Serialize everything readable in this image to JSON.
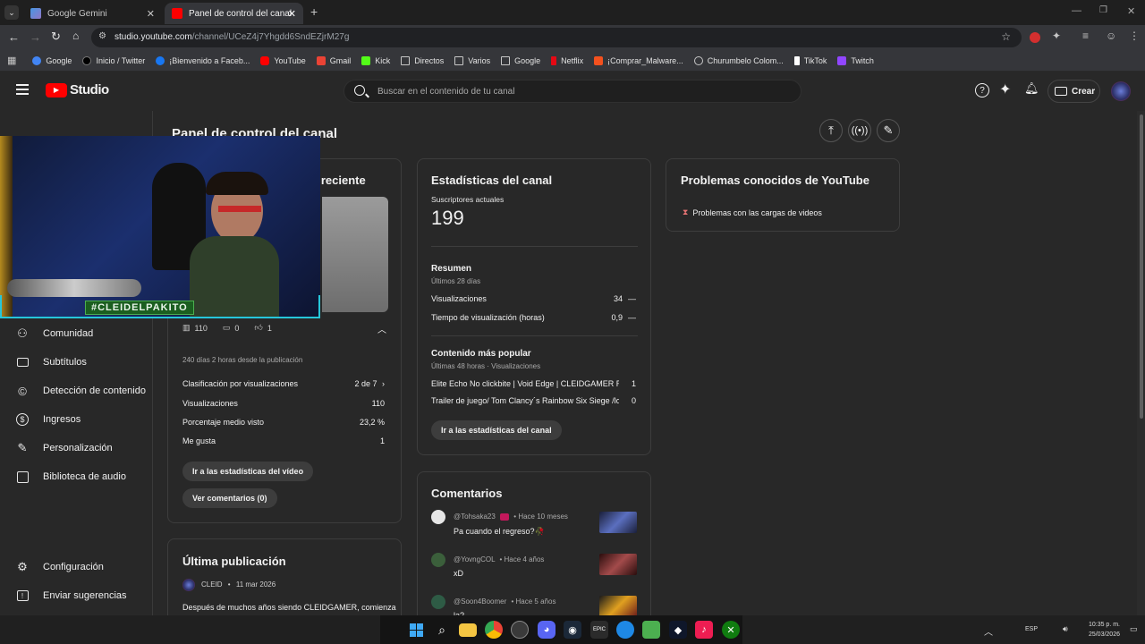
{
  "browser": {
    "tabs": [
      {
        "title": "Google Gemini",
        "active": false
      },
      {
        "title": "Panel de control del canal - You",
        "active": true
      }
    ],
    "url_host": "studio.youtube.com",
    "url_path": "/channel/UCeZ4j7Yhgdd6SndEZjrM27g",
    "bookmarks": [
      {
        "label": "Google",
        "color": "#4285f4"
      },
      {
        "label": "Inicio / Twitter",
        "color": "#ffffff"
      },
      {
        "label": "¡Bienvenido a Faceb...",
        "color": "#1877f2"
      },
      {
        "label": "YouTube",
        "color": "#ff0000"
      },
      {
        "label": "Gmail",
        "color": "#ea4335"
      },
      {
        "label": "Kick",
        "color": "#53fc18"
      },
      {
        "label": "Directos",
        "color": "#c7c7c7"
      },
      {
        "label": "Varios",
        "color": "#c7c7c7"
      },
      {
        "label": "Google",
        "color": "#c7c7c7"
      },
      {
        "label": "Netflix",
        "color": "#e50914"
      },
      {
        "label": "¡Comprar_Malware...",
        "color": "#f4511e"
      },
      {
        "label": "Churumbelo Colom...",
        "color": "#c7c7c7"
      },
      {
        "label": "TikTok",
        "color": "#ffffff"
      },
      {
        "label": "Twitch",
        "color": "#9146ff"
      }
    ]
  },
  "header": {
    "logo_text": "Studio",
    "search_placeholder": "Buscar en el contenido de tu canal",
    "create_label": "Crear"
  },
  "sidebar": {
    "items": [
      {
        "label": "Comunidad",
        "icon": "people-icon"
      },
      {
        "label": "Subtítulos",
        "icon": "subtitles-icon"
      },
      {
        "label": "Detección de contenido",
        "icon": "copyright-icon"
      },
      {
        "label": "Ingresos",
        "icon": "dollar-icon"
      },
      {
        "label": "Personalización",
        "icon": "magic-wand-icon"
      },
      {
        "label": "Biblioteca de audio",
        "icon": "audio-library-icon"
      }
    ],
    "bottom": [
      {
        "label": "Configuración",
        "icon": "gear-icon"
      },
      {
        "label": "Enviar sugerencias",
        "icon": "feedback-icon"
      }
    ]
  },
  "page": {
    "title": "Panel de control del canal"
  },
  "webcam": {
    "tag": "#CLEIDELPAKITO"
  },
  "latest_video": {
    "title_fragment": "s reciente",
    "views_count": "110",
    "comments_count": "0",
    "likes_count": "1",
    "since": "240 días 2 horas desde la publicación",
    "rows": [
      {
        "label": "Clasificación por visualizaciones",
        "value": "2 de 7"
      },
      {
        "label": "Visualizaciones",
        "value": "110"
      },
      {
        "label": "Porcentaje medio visto",
        "value": "23,2 %"
      },
      {
        "label": "Me gusta",
        "value": "1"
      }
    ],
    "btn_stats": "Ir a las estadísticas del vídeo",
    "btn_comments": "Ver comentarios (0)"
  },
  "latest_post": {
    "title": "Última publicación",
    "author": "CLEID",
    "date": "11 mar 2026",
    "text": "Después de muchos años siendo CLEIDGAMER, comienza"
  },
  "stats": {
    "title": "Estadísticas del canal",
    "subs_label": "Suscriptores actuales",
    "subs_value": "199",
    "summary_title": "Resumen",
    "summary_sub": "Últimos 28 días",
    "rows": [
      {
        "label": "Visualizaciones",
        "value": "34",
        "trend": "—"
      },
      {
        "label": "Tiempo de visualización (horas)",
        "value": "0,9",
        "trend": "—"
      }
    ],
    "popular_title": "Contenido más popular",
    "popular_sub": "Últimas 48 horas · Visualizaciones",
    "popular": [
      {
        "label": "Elite Echo No clickbite | Void Edge | CLEIDGAMER Rain...",
        "value": "1"
      },
      {
        "label": "Trailer de juego/ Tom Clancy´s Rainbow Six Siege /lo q...",
        "value": "0"
      }
    ],
    "btn": "Ir a las estadísticas del canal"
  },
  "comments": {
    "title": "Comentarios",
    "items": [
      {
        "user": "@Tohsaka23",
        "when": "• Hace 10 meses",
        "text": "Pa cuando el regreso?🥀"
      },
      {
        "user": "@YovngCOL",
        "when": "• Hace 4 años",
        "text": "xD"
      },
      {
        "user": "@Soon4Boomer",
        "when": "• Hace 5 años",
        "text": "la?"
      }
    ]
  },
  "problems": {
    "title": "Problemas conocidos de YouTube",
    "item": "Problemas con las cargas de videos"
  },
  "taskbar": {
    "lang": "ESP",
    "time": "10:35 p. m.",
    "date": "25/03/2026"
  }
}
